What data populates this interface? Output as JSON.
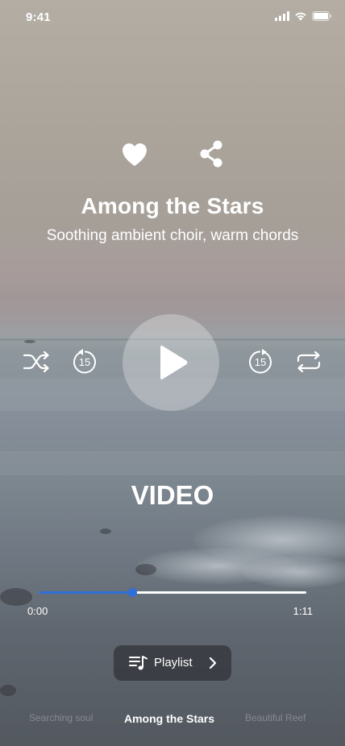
{
  "status_bar": {
    "time": "9:41"
  },
  "song": {
    "title": "Among the Stars",
    "subtitle": "Soothing ambient choir, warm chords"
  },
  "controls": {
    "rewind_seconds": "15",
    "forward_seconds": "15"
  },
  "media": {
    "label": "VIDEO"
  },
  "progress": {
    "elapsed": "0:00",
    "total": "1:11",
    "fraction": 0.35
  },
  "playlist_button": {
    "label": "Playlist"
  },
  "carousel": {
    "previous": "Searching soul",
    "current": "Among the Stars",
    "next": "Beautiful Reef"
  },
  "colors": {
    "accent": "#2f6fd8",
    "text": "#ffffff"
  },
  "icons": [
    "heart-icon",
    "share-icon",
    "shuffle-icon",
    "rewind-15-icon",
    "play-icon",
    "forward-15-icon",
    "repeat-icon",
    "playlist-icon",
    "chevron-right-icon",
    "signal-icon",
    "wifi-icon",
    "battery-icon"
  ]
}
